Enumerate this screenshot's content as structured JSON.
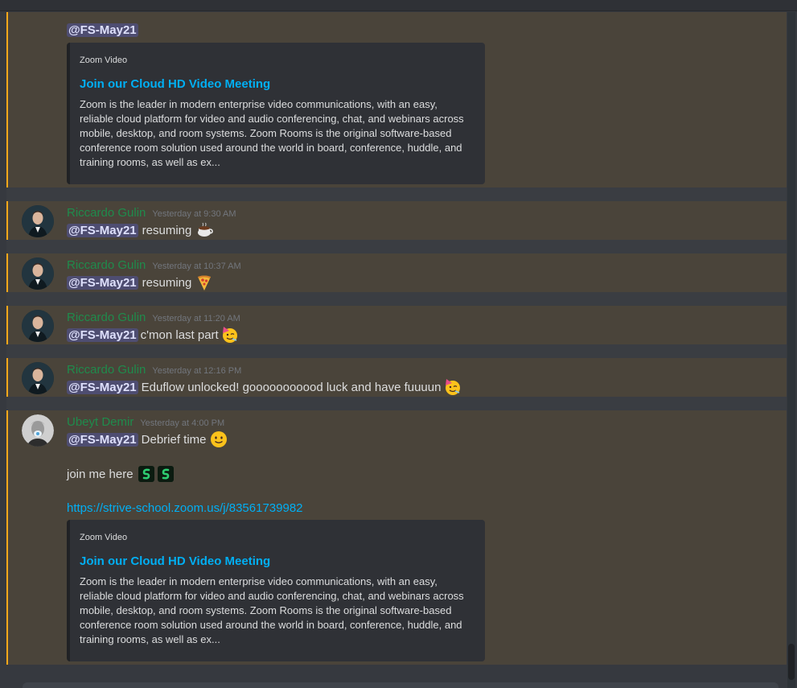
{
  "messages": {
    "m0": {
      "mention": "@FS-May21",
      "embed": {
        "provider": "Zoom Video",
        "title": "Join our Cloud HD Video Meeting",
        "description": "Zoom is the leader in modern enterprise video communications, with an easy, reliable cloud platform for video and audio conferencing, chat, and webinars across mobile, desktop, and room systems. Zoom Rooms is the original software-based conference room solution used around the world in board, conference, huddle, and training rooms, as well as ex..."
      }
    },
    "m1": {
      "username": "Riccardo Gulin",
      "timestamp": "Yesterday at 9:30 AM",
      "mention": "@FS-May21",
      "text": "resuming",
      "emoji": "coffee-icon"
    },
    "m2": {
      "username": "Riccardo Gulin",
      "timestamp": "Yesterday at 10:37 AM",
      "mention": "@FS-May21",
      "text": "resuming",
      "emoji": "pizza-icon"
    },
    "m3": {
      "username": "Riccardo Gulin",
      "timestamp": "Yesterday at 11:20 AM",
      "mention": "@FS-May21",
      "text": "c'mon last part",
      "emoji": "party-face-icon"
    },
    "m4": {
      "username": "Riccardo Gulin",
      "timestamp": "Yesterday at 12:16 PM",
      "mention": "@FS-May21",
      "text": "Eduflow unlocked! gooooooooood luck and have fuuuun",
      "emoji": "party-face-icon"
    },
    "m5": {
      "username": "Ubeyt Demir",
      "timestamp": "Yesterday at 4:00 PM",
      "mention": "@FS-May21",
      "text": "Debrief time",
      "emoji": "slight-smile-icon",
      "line2": "join me here",
      "line2_emojis": [
        "strive-emote-icon",
        "strive-emote-icon"
      ],
      "link": "https://strive-school.zoom.us/j/83561739982",
      "embed": {
        "provider": "Zoom Video",
        "title": "Join our Cloud HD Video Meeting",
        "description": "Zoom is the leader in modern enterprise video communications, with an easy, reliable cloud platform for video and audio conferencing, chat, and webinars across mobile, desktop, and room systems. Zoom Rooms is the original software-based conference room solution used around the world in board, conference, huddle, and training rooms, as well as ex..."
      }
    }
  },
  "colors": {
    "mention_bg": "#4a443a",
    "mention_bar": "#faa81a",
    "username": "#1f8b4c",
    "link": "#00aff4"
  }
}
